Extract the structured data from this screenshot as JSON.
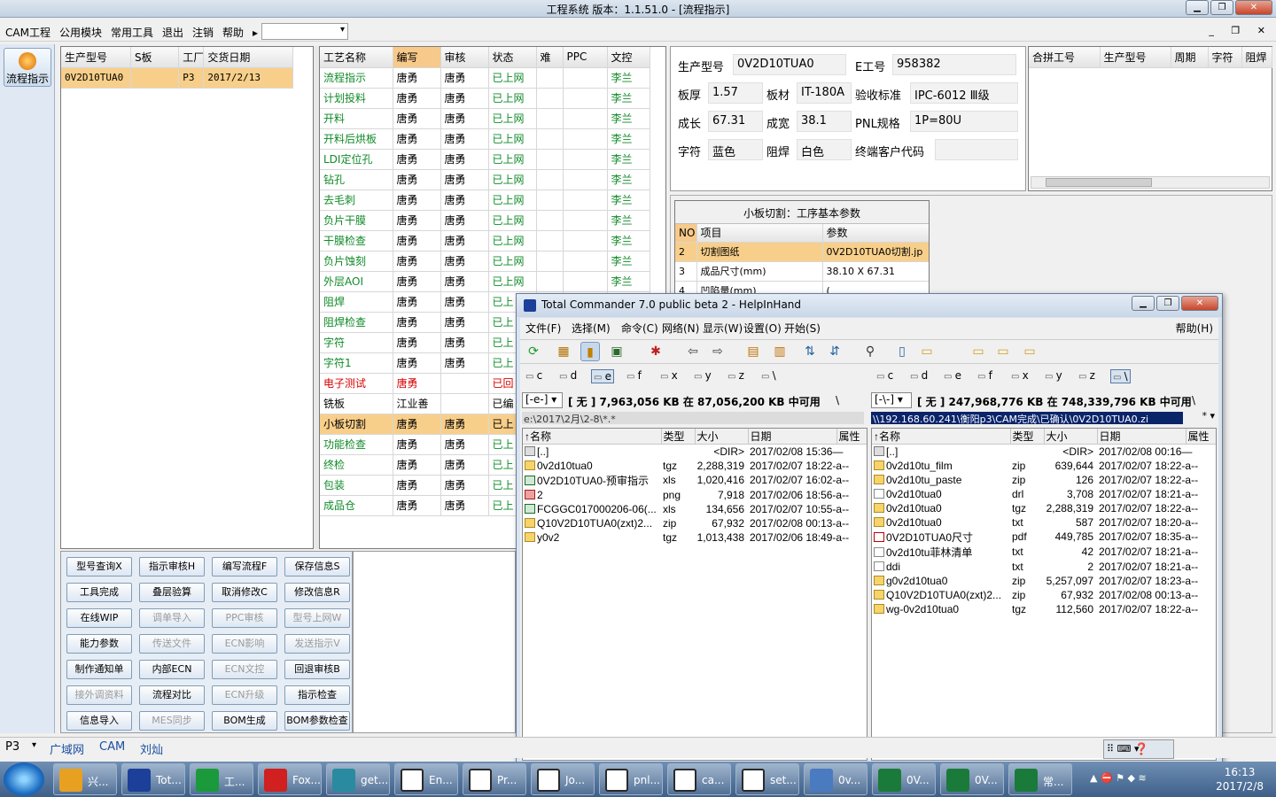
{
  "app": {
    "title": "工程系统   版本：1.1.51.0 - [流程指示]",
    "blurred_tab": "▁▁▁▁▁▁▁▁▁▁▁▁▁▁▁▁"
  },
  "menu": [
    "CAM工程",
    "公用模块",
    "常用工具",
    "退出",
    "注销",
    "帮助"
  ],
  "left_button": "流程指示",
  "order_grid": {
    "headers": [
      "生产型号",
      "S板",
      "工厂",
      "交货日期"
    ],
    "rows": [
      [
        "0V2D10TUA0",
        "",
        "P3",
        "2017/2/13"
      ]
    ]
  },
  "process_grid": {
    "headers": [
      "工艺名称",
      "编写",
      "审核",
      "状态",
      "难",
      "PPC",
      "文控"
    ],
    "rows": [
      [
        "流程指示",
        "唐勇",
        "唐勇",
        "已上网",
        "",
        "",
        "李兰"
      ],
      [
        "计划投料",
        "唐勇",
        "唐勇",
        "已上网",
        "",
        "",
        "李兰"
      ],
      [
        "开料",
        "唐勇",
        "唐勇",
        "已上网",
        "",
        "",
        "李兰"
      ],
      [
        "开料后烘板",
        "唐勇",
        "唐勇",
        "已上网",
        "",
        "",
        "李兰"
      ],
      [
        "LDI定位孔",
        "唐勇",
        "唐勇",
        "已上网",
        "",
        "",
        "李兰"
      ],
      [
        "钻孔",
        "唐勇",
        "唐勇",
        "已上网",
        "",
        "",
        "李兰"
      ],
      [
        "去毛刺",
        "唐勇",
        "唐勇",
        "已上网",
        "",
        "",
        "李兰"
      ],
      [
        "负片干膜",
        "唐勇",
        "唐勇",
        "已上网",
        "",
        "",
        "李兰"
      ],
      [
        "干膜检查",
        "唐勇",
        "唐勇",
        "已上网",
        "",
        "",
        "李兰"
      ],
      [
        "负片蚀刻",
        "唐勇",
        "唐勇",
        "已上网",
        "",
        "",
        "李兰"
      ],
      [
        "外层AOI",
        "唐勇",
        "唐勇",
        "已上网",
        "",
        "",
        "李兰"
      ],
      [
        "阻焊",
        "唐勇",
        "唐勇",
        "已上",
        "",
        "",
        ""
      ],
      [
        "阻焊检查",
        "唐勇",
        "唐勇",
        "已上",
        "",
        "",
        ""
      ],
      [
        "字符",
        "唐勇",
        "唐勇",
        "已上",
        "",
        "",
        ""
      ],
      [
        "字符1",
        "唐勇",
        "唐勇",
        "已上",
        "",
        "",
        ""
      ],
      [
        "电子测试",
        "唐勇",
        "",
        "已回",
        "",
        "",
        ""
      ],
      [
        "铣板",
        "江业善",
        "",
        "已编",
        "",
        "",
        ""
      ],
      [
        "小板切割",
        "唐勇",
        "唐勇",
        "已上",
        "",
        "",
        ""
      ],
      [
        "功能检查",
        "唐勇",
        "唐勇",
        "已上",
        "",
        "",
        ""
      ],
      [
        "终检",
        "唐勇",
        "唐勇",
        "已上",
        "",
        "",
        ""
      ],
      [
        "包装",
        "唐勇",
        "唐勇",
        "已上",
        "",
        "",
        ""
      ],
      [
        "成品仓",
        "唐勇",
        "唐勇",
        "已上",
        "",
        "",
        ""
      ]
    ]
  },
  "buttons": [
    [
      "型号查询X",
      "指示审核H",
      "编写流程F",
      "保存信息S"
    ],
    [
      "工具完成",
      "叠层验算",
      "取消修改C",
      "修改信息R"
    ],
    [
      "在线WIP",
      "调单导入",
      "PPC审核",
      "型号上网W"
    ],
    [
      "能力参数",
      "传送文件",
      "ECN影响",
      "发送指示V"
    ],
    [
      "制作通知单",
      "内部ECN",
      "ECN文控",
      "回退审核B"
    ],
    [
      "接外调资料",
      "流程对比",
      "ECN升级",
      "指示检查"
    ],
    [
      "信息导入",
      "MES同步",
      "BOM生成",
      "BOM参数检查"
    ]
  ],
  "disabled_buttons": [
    "调单导入",
    "PPC审核",
    "型号上网W",
    "传送文件",
    "ECN影响",
    "发送指示V",
    "ECN文控",
    "接外调资料",
    "ECN升级",
    "MES同步"
  ],
  "info": {
    "生产型号": "0V2D10TUA0",
    "E工号": "958382",
    "板厚": "1.57",
    "板材": "IT-180A",
    "验收标准": "IPC-6012 Ⅲ级",
    "成长": "67.31",
    "成宽": "38.1",
    "PNL规格": "1P=80U",
    "字符": "蓝色",
    "阻焊": "白色",
    "终端客户代码": ""
  },
  "info_labels": [
    "生产型号",
    "E工号",
    "板厚",
    "板材",
    "验收标准",
    "成长",
    "成宽",
    "PNL规格",
    "字符",
    "阻焊",
    "终端客户代码"
  ],
  "merge_grid": {
    "headers": [
      "合拼工号",
      "生产型号",
      "周期",
      "字符",
      "阻焊"
    ]
  },
  "cut_params": {
    "title": "小板切割：工序基本参数",
    "headers": [
      "NO",
      "项目",
      "参数"
    ],
    "rows": [
      [
        "2",
        "切割图纸",
        "0V2D10TUA0切割.jp"
      ],
      [
        "3",
        "成品尺寸(mm)",
        "38.10 X 67.31"
      ],
      [
        "4",
        "凹陷量(mm)",
        "("
      ]
    ]
  },
  "tc": {
    "title": "Total Commander 7.0 public beta 2 - HelpInHand",
    "menu": [
      "文件(F)",
      "选择(M)",
      "命令(C)",
      "网络(N)",
      "显示(W)",
      "设置(O)",
      "开始(S)"
    ],
    "help": "帮助(H)",
    "drives": [
      "c",
      "d",
      "e",
      "f",
      "x",
      "y",
      "z",
      "\\"
    ],
    "left": {
      "drive": "[-e-]",
      "space": "[ 无 ]  7,963,056 KB 在 87,056,200 KB 中可用",
      "root": "\\",
      "path": "e:\\2017\\2月\\2-8\\*.*",
      "files": [
        [
          "up",
          "[..]",
          "",
          "<DIR>",
          "2017/02/08 15:36—"
        ],
        [
          "arc",
          "0v2d10tua0",
          "tgz",
          "2,288,319",
          "2017/02/07 18:22-a--"
        ],
        [
          "xls",
          "0V2D10TUA0-预审指示",
          "xls",
          "1,020,416",
          "2017/02/07 16:02-a--"
        ],
        [
          "png",
          "2",
          "png",
          "7,918",
          "2017/02/06 18:56-a--"
        ],
        [
          "xls",
          "FCGGC017000206-06(...",
          "xls",
          "134,656",
          "2017/02/07 10:55-a--"
        ],
        [
          "arc",
          "Q10V2D10TUA0(zxt)2...",
          "zip",
          "67,932",
          "2017/02/08 00:13-a--"
        ],
        [
          "arc",
          "y0v2",
          "tgz",
          "1,013,438",
          "2017/02/06 18:49-a--"
        ]
      ]
    },
    "right": {
      "drive": "[-\\-]",
      "space": "[ 无 ]  247,968,776 KB 在 748,339,796 KB 中可用",
      "root": "\\",
      "path": "\\\\192.168.60.241\\衡阳p3\\CAM完成\\已确认\\0V2D10TUA0.zi",
      "files": [
        [
          "up",
          "[..]",
          "",
          "<DIR>",
          "2017/02/08 00:16—"
        ],
        [
          "arc",
          "0v2d10tu_film",
          "zip",
          "639,644",
          "2017/02/07 18:22-a--"
        ],
        [
          "arc",
          "0v2d10tu_paste",
          "zip",
          "126",
          "2017/02/07 18:22-a--"
        ],
        [
          "txt",
          "0v2d10tua0",
          "drl",
          "3,708",
          "2017/02/07 18:21-a--"
        ],
        [
          "arc",
          "0v2d10tua0",
          "tgz",
          "2,288,319",
          "2017/02/07 18:22-a--"
        ],
        [
          "arc",
          "0v2d10tua0",
          "txt",
          "587",
          "2017/02/07 18:20-a--"
        ],
        [
          "pdf",
          "0V2D10TUA0尺寸",
          "pdf",
          "449,785",
          "2017/02/07 18:35-a--"
        ],
        [
          "txt",
          "0v2d10tu菲林清单",
          "txt",
          "42",
          "2017/02/07 18:21-a--"
        ],
        [
          "txt",
          "ddi",
          "txt",
          "2",
          "2017/02/07 18:21-a--"
        ],
        [
          "arc",
          "g0v2d10tua0",
          "zip",
          "5,257,097",
          "2017/02/07 18:23-a--"
        ],
        [
          "arc",
          "Q10V2D10TUA0(zxt)2...",
          "zip",
          "67,932",
          "2017/02/08 00:13-a--"
        ],
        [
          "arc",
          "wg-0v2d10tua0",
          "tgz",
          "112,560",
          "2017/02/07 18:22-a--"
        ]
      ]
    },
    "col_headers": [
      "↑名称",
      "类型",
      "大小",
      "日期",
      "属性"
    ]
  },
  "statusbar": {
    "factory": "P3",
    "net": "广域网",
    "cam": "CAM",
    "user": "刘灿"
  },
  "taskbar": {
    "items": [
      "兴...",
      "Tot...",
      "工...",
      "Fox...",
      "get...",
      "En...",
      "Pr...",
      "Jo...",
      "pnl...",
      "ca...",
      "set...",
      "0v...",
      "0V...",
      "0V...",
      "常..."
    ],
    "time": "16:13",
    "date": "2017/2/8"
  }
}
